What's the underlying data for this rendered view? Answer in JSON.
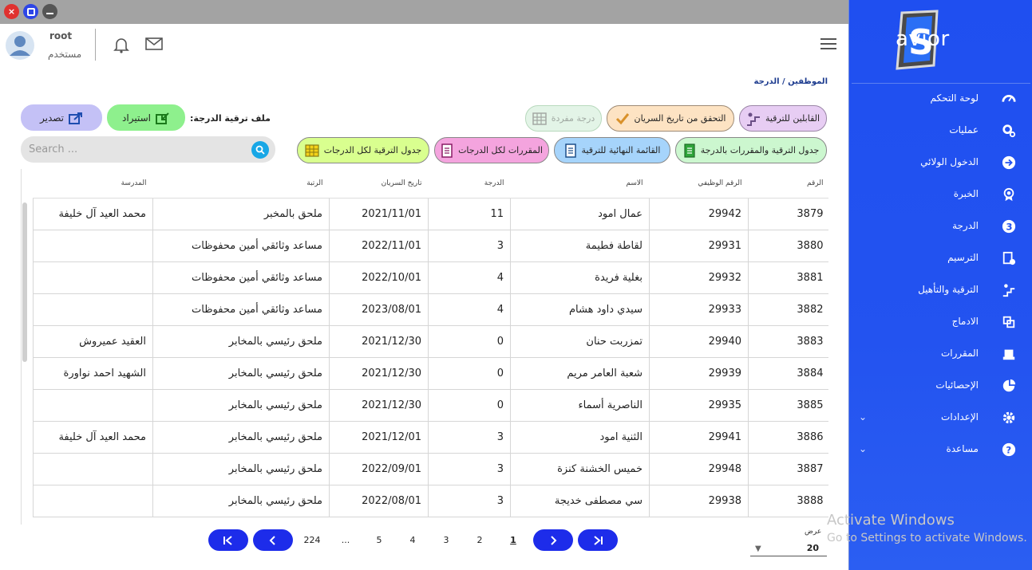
{
  "window": {
    "close_label": "×"
  },
  "header": {
    "username": "root",
    "role": "مستخدم"
  },
  "breadcrumb": {
    "items": [
      "الموظفين",
      "/",
      "الدرجة"
    ]
  },
  "sidebar": {
    "logo_text": "avior",
    "logo_letter": "S",
    "items": [
      {
        "label": "لوحة التحكم",
        "icon": "dashboard-icon"
      },
      {
        "label": "عمليات",
        "icon": "gears-icon"
      },
      {
        "label": "الدخول الولائي",
        "icon": "arrow-right-circle-icon"
      },
      {
        "label": "الخبرة",
        "icon": "award-icon"
      },
      {
        "label": "الدرجة",
        "icon": "number-3-icon"
      },
      {
        "label": "الترسيم",
        "icon": "document-check-icon"
      },
      {
        "label": "الترقية والتأهيل",
        "icon": "stairs-icon"
      },
      {
        "label": "الادماج",
        "icon": "merge-icon"
      },
      {
        "label": "المقررات",
        "icon": "stamp-icon"
      },
      {
        "label": "الإحصائيات",
        "icon": "pie-chart-icon"
      },
      {
        "label": "الإعدادات",
        "icon": "settings-icon",
        "chevron": "⌄"
      },
      {
        "label": "مساعدة",
        "icon": "help-icon",
        "chevron": "⌄"
      }
    ]
  },
  "actions": {
    "export": "تصدير",
    "import": "استيراد",
    "file_label": "ملف ترقية الدرجة:",
    "single_grade": "درجة مفردة",
    "verify_date": "التحقق من تاريخ السريان",
    "eligible": "القابلين للترقية",
    "all_grades_table": "جدول الترقية لكل الدرجات",
    "courses_all": "المقررات لكل الدرجات",
    "final_list": "القائمة النهائية للترقية",
    "table_with_courses": "جدول الترقية والمقررات بالدرجة"
  },
  "search": {
    "placeholder": "Search ..."
  },
  "table": {
    "headers": [
      "الرقم",
      "الرقم الوظيفي",
      "الاسم",
      "الدرجة",
      "تاريخ السريان",
      "الرتبة",
      "المدرسة"
    ],
    "rows": [
      [
        "3879",
        "29942",
        "عمال امود",
        "11",
        "2021/11/01",
        "ملحق بالمخبر",
        "محمد العيد آل خليفة"
      ],
      [
        "3880",
        "29931",
        "لقاطة فطيمة",
        "3",
        "2022/11/01",
        "مساعد وثائقي أمين محفوظات",
        ""
      ],
      [
        "3881",
        "29932",
        "بغلية فريدة",
        "4",
        "2022/10/01",
        "مساعد وثائقي أمين محفوظات",
        ""
      ],
      [
        "3882",
        "29933",
        "سيدي داود هشام",
        "4",
        "2023/08/01",
        "مساعد وثائقي أمين محفوظات",
        ""
      ],
      [
        "3883",
        "29940",
        "تمزربت حنان",
        "0",
        "2021/12/30",
        "ملحق رئيسي بالمخابر",
        "العقيد عميروش"
      ],
      [
        "3884",
        "29939",
        "شعبة العامر مريم",
        "0",
        "2021/12/30",
        "ملحق رئيسي بالمخابر",
        "الشهيد احمد نواورة"
      ],
      [
        "3885",
        "29935",
        "الناصرية أسماء",
        "0",
        "2021/12/30",
        "ملحق رئيسي بالمخابر",
        ""
      ],
      [
        "3886",
        "29941",
        "الثنية امود",
        "3",
        "2021/12/01",
        "ملحق رئيسي بالمخابر",
        "محمد العيد آل خليفة"
      ],
      [
        "3887",
        "29948",
        "خميس الخشنة كنزة",
        "3",
        "2022/09/01",
        "ملحق رئيسي بالمخابر",
        ""
      ],
      [
        "3888",
        "29938",
        "سي مصطفى خديجة",
        "3",
        "2022/08/01",
        "ملحق رئيسي بالمخابر",
        ""
      ]
    ]
  },
  "pagination": {
    "first": "⏮",
    "prev": "‹",
    "next": "›",
    "last": "⏭",
    "pages": [
      "224",
      "...",
      "5",
      "4",
      "3",
      "2",
      "1"
    ],
    "current": "1"
  },
  "page_size": {
    "label": "عرض",
    "value": "20"
  },
  "activation": {
    "line1": "Activate Windows",
    "line2": "Go to Settings to activate Windows."
  },
  "colors": {
    "sidebar": "#2353f0",
    "pager": "#1d2cea",
    "search_button": "#18a7e6"
  }
}
